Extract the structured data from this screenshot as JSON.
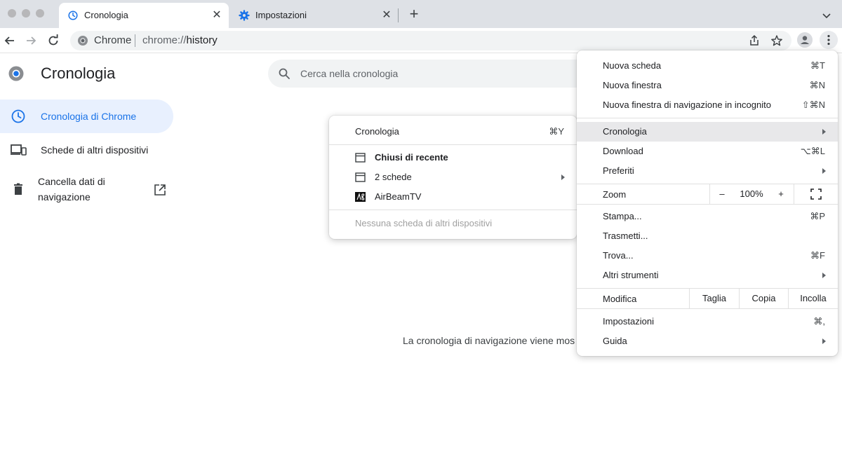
{
  "tabs": [
    {
      "title": "Cronologia",
      "active": true
    },
    {
      "title": "Impostazioni",
      "active": false
    }
  ],
  "omnibox": {
    "site": "Chrome",
    "url_prefix": "chrome://",
    "url_path": "history"
  },
  "page": {
    "title": "Cronologia",
    "search_placeholder": "Cerca nella cronologia",
    "sidebar": [
      {
        "label": "Cronologia di Chrome",
        "active": true
      },
      {
        "label": "Schede di altri dispositivi",
        "active": false
      },
      {
        "label": "Cancella dati di navigazione",
        "active": false
      }
    ],
    "empty_message": "La cronologia di navigazione viene mos"
  },
  "main_menu": {
    "items": [
      {
        "label": "Nuova scheda",
        "shortcut": "⌘T"
      },
      {
        "label": "Nuova finestra",
        "shortcut": "⌘N"
      },
      {
        "label": "Nuova finestra di navigazione in incognito",
        "shortcut": "⇧⌘N"
      },
      {
        "label": "Cronologia",
        "submenu": true
      },
      {
        "label": "Download",
        "shortcut": "⌥⌘L"
      },
      {
        "label": "Preferiti",
        "submenu": true
      },
      {
        "label": "Stampa...",
        "shortcut": "⌘P"
      },
      {
        "label": "Trasmetti..."
      },
      {
        "label": "Trova...",
        "shortcut": "⌘F"
      },
      {
        "label": "Altri strumenti",
        "submenu": true
      },
      {
        "label": "Impostazioni",
        "shortcut": "⌘,"
      },
      {
        "label": "Guida",
        "submenu": true
      }
    ],
    "zoom": {
      "label": "Zoom",
      "minus": "–",
      "value": "100%",
      "plus": "+"
    },
    "edit": {
      "label": "Modifica",
      "cut": "Taglia",
      "copy": "Copia",
      "paste": "Incolla"
    }
  },
  "history_submenu": {
    "items": [
      {
        "label": "Cronologia",
        "shortcut": "⌘Y"
      },
      {
        "label": "Chiusi di recente"
      },
      {
        "label": "2 schede",
        "submenu": true
      },
      {
        "label": "AirBeamTV"
      },
      {
        "label": "Nessuna scheda di altri dispositivi"
      }
    ]
  },
  "colors": {
    "accent": "#1a73e8",
    "tabstrip": "#dee1e6",
    "sidebar_active_bg": "#e8f0fe",
    "menu_highlight": "#e8e8ea"
  }
}
